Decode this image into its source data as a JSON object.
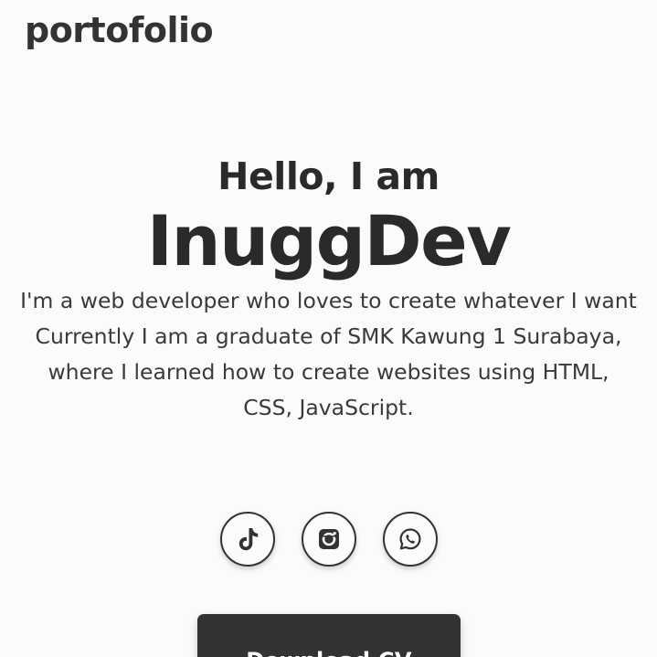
{
  "header": {
    "brand": "portofolio"
  },
  "hero": {
    "greeting": "Hello, I am",
    "name": "InuggDev",
    "bio_line1": "I'm a web developer who loves to create whatever I want",
    "bio_line2": "Currently I am a graduate of SMK Kawung 1 Surabaya, where I learned how to create websites using HTML, CSS, JavaScript."
  },
  "socials": [
    {
      "icon": "tiktok-icon"
    },
    {
      "icon": "instagram-icon"
    },
    {
      "icon": "whatsapp-icon"
    }
  ],
  "cta": {
    "download_cv_label": "Download CV"
  },
  "colors": {
    "background": "#fbfbfb",
    "text": "#2e2e2e",
    "button": "#333333"
  }
}
